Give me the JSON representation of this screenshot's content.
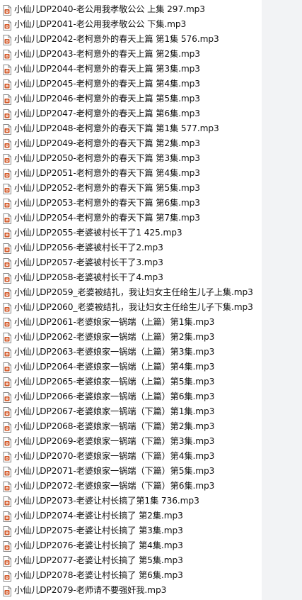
{
  "files": [
    {
      "name": "小仙儿DP2040-老公用我孝敬公公 上集 297.mp3",
      "icon": "audio-file-icon"
    },
    {
      "name": "小仙儿DP2041-老公用我孝敬公公 下集.mp3",
      "icon": "audio-file-icon"
    },
    {
      "name": "小仙儿DP2042-老柯意外的春天上篇 第1集 576.mp3",
      "icon": "audio-file-icon"
    },
    {
      "name": "小仙儿DP2043-老柯意外的春天上篇 第2集.mp3",
      "icon": "audio-file-icon"
    },
    {
      "name": "小仙儿DP2044-老柯意外的春天上篇 第3集.mp3",
      "icon": "audio-file-icon"
    },
    {
      "name": "小仙儿DP2045-老柯意外的春天上篇 第4集.mp3",
      "icon": "audio-file-icon"
    },
    {
      "name": "小仙儿DP2046-老柯意外的春天上篇 第5集.mp3",
      "icon": "audio-file-icon"
    },
    {
      "name": "小仙儿DP2047-老柯意外的春天上篇 第6集.mp3",
      "icon": "audio-file-icon"
    },
    {
      "name": "小仙儿DP2048-老柯意外的春天下篇 第1集 577.mp3",
      "icon": "audio-file-icon"
    },
    {
      "name": "小仙儿DP2049-老柯意外的春天下篇 第2集.mp3",
      "icon": "audio-file-icon"
    },
    {
      "name": "小仙儿DP2050-老柯意外的春天下篇 第3集.mp3",
      "icon": "audio-file-icon"
    },
    {
      "name": "小仙儿DP2051-老柯意外的春天下篇 第4集.mp3",
      "icon": "audio-file-icon"
    },
    {
      "name": "小仙儿DP2052-老柯意外的春天下篇 第5集.mp3",
      "icon": "audio-file-icon"
    },
    {
      "name": "小仙儿DP2053-老柯意外的春天下篇 第6集.mp3",
      "icon": "audio-file-icon"
    },
    {
      "name": "小仙儿DP2054-老柯意外的春天下篇 第7集.mp3",
      "icon": "audio-file-icon"
    },
    {
      "name": "小仙儿DP2055-老婆被村长干了1 425.mp3",
      "icon": "audio-file-icon"
    },
    {
      "name": "小仙儿DP2056-老婆被村长干了2.mp3",
      "icon": "audio-file-icon"
    },
    {
      "name": "小仙儿DP2057-老婆被村长干了3.mp3",
      "icon": "audio-file-icon"
    },
    {
      "name": "小仙儿DP2058-老婆被村长干了4.mp3",
      "icon": "audio-file-icon"
    },
    {
      "name": "小仙儿DP2059_老婆被结扎，我让妇女主任给生儿子上集.mp3",
      "icon": "audio-file-icon"
    },
    {
      "name": "小仙儿DP2060_老婆被结扎，我让妇女主任给生儿子下集.mp3",
      "icon": "audio-file-icon"
    },
    {
      "name": "小仙儿DP2061-老婆娘家一锅端（上篇）第1集.mp3",
      "icon": "audio-file-icon"
    },
    {
      "name": "小仙儿DP2062-老婆娘家一锅端（上篇）第2集.mp3",
      "icon": "audio-file-icon"
    },
    {
      "name": "小仙儿DP2063-老婆娘家一锅端（上篇）第3集.mp3",
      "icon": "audio-file-icon"
    },
    {
      "name": "小仙儿DP2064-老婆娘家一锅端（上篇）第4集.mp3",
      "icon": "audio-file-icon"
    },
    {
      "name": "小仙儿DP2065-老婆娘家一锅端（上篇）第5集.mp3",
      "icon": "audio-file-icon"
    },
    {
      "name": "小仙儿DP2066-老婆娘家一锅端（上篇）第6集.mp3",
      "icon": "audio-file-icon"
    },
    {
      "name": "小仙儿DP2067-老婆娘家一锅端（下篇）第1集.mp3",
      "icon": "audio-file-icon"
    },
    {
      "name": "小仙儿DP2068-老婆娘家一锅端（下篇）第2集.mp3",
      "icon": "audio-file-icon"
    },
    {
      "name": "小仙儿DP2069-老婆娘家一锅端（下篇）第3集.mp3",
      "icon": "audio-file-icon"
    },
    {
      "name": "小仙儿DP2070-老婆娘家一锅端（下篇）第4集.mp3",
      "icon": "audio-file-icon"
    },
    {
      "name": "小仙儿DP2071-老婆娘家一锅端（下篇）第5集.mp3",
      "icon": "audio-file-icon"
    },
    {
      "name": "小仙儿DP2072-老婆娘家一锅端（下篇）第6集.mp3",
      "icon": "audio-file-icon"
    },
    {
      "name": "小仙儿DP2073-老婆让村长搞了第1集 736.mp3",
      "icon": "audio-file-icon"
    },
    {
      "name": "小仙儿DP2074-老婆让村长搞了 第2集.mp3",
      "icon": "audio-file-icon"
    },
    {
      "name": "小仙儿DP2075-老婆让村长搞了 第3集.mp3",
      "icon": "audio-file-icon"
    },
    {
      "name": "小仙儿DP2076-老婆让村长搞了 第4集.mp3",
      "icon": "audio-file-icon"
    },
    {
      "name": "小仙儿DP2077-老婆让村长搞了 第5集.mp3",
      "icon": "audio-file-icon"
    },
    {
      "name": "小仙儿DP2078-老婆让村长搞了 第6集.mp3",
      "icon": "audio-file-icon"
    },
    {
      "name": "小仙儿DP2079-老师请不要强奸我.mp3",
      "icon": "audio-file-icon"
    }
  ],
  "colors": {
    "background": "#ffffff",
    "gutter": "#f2f3f5",
    "text": "#111111",
    "icon_border": "#8a8a8a",
    "icon_fill": "#ffffff",
    "icon_accent": "#d35a2a"
  }
}
